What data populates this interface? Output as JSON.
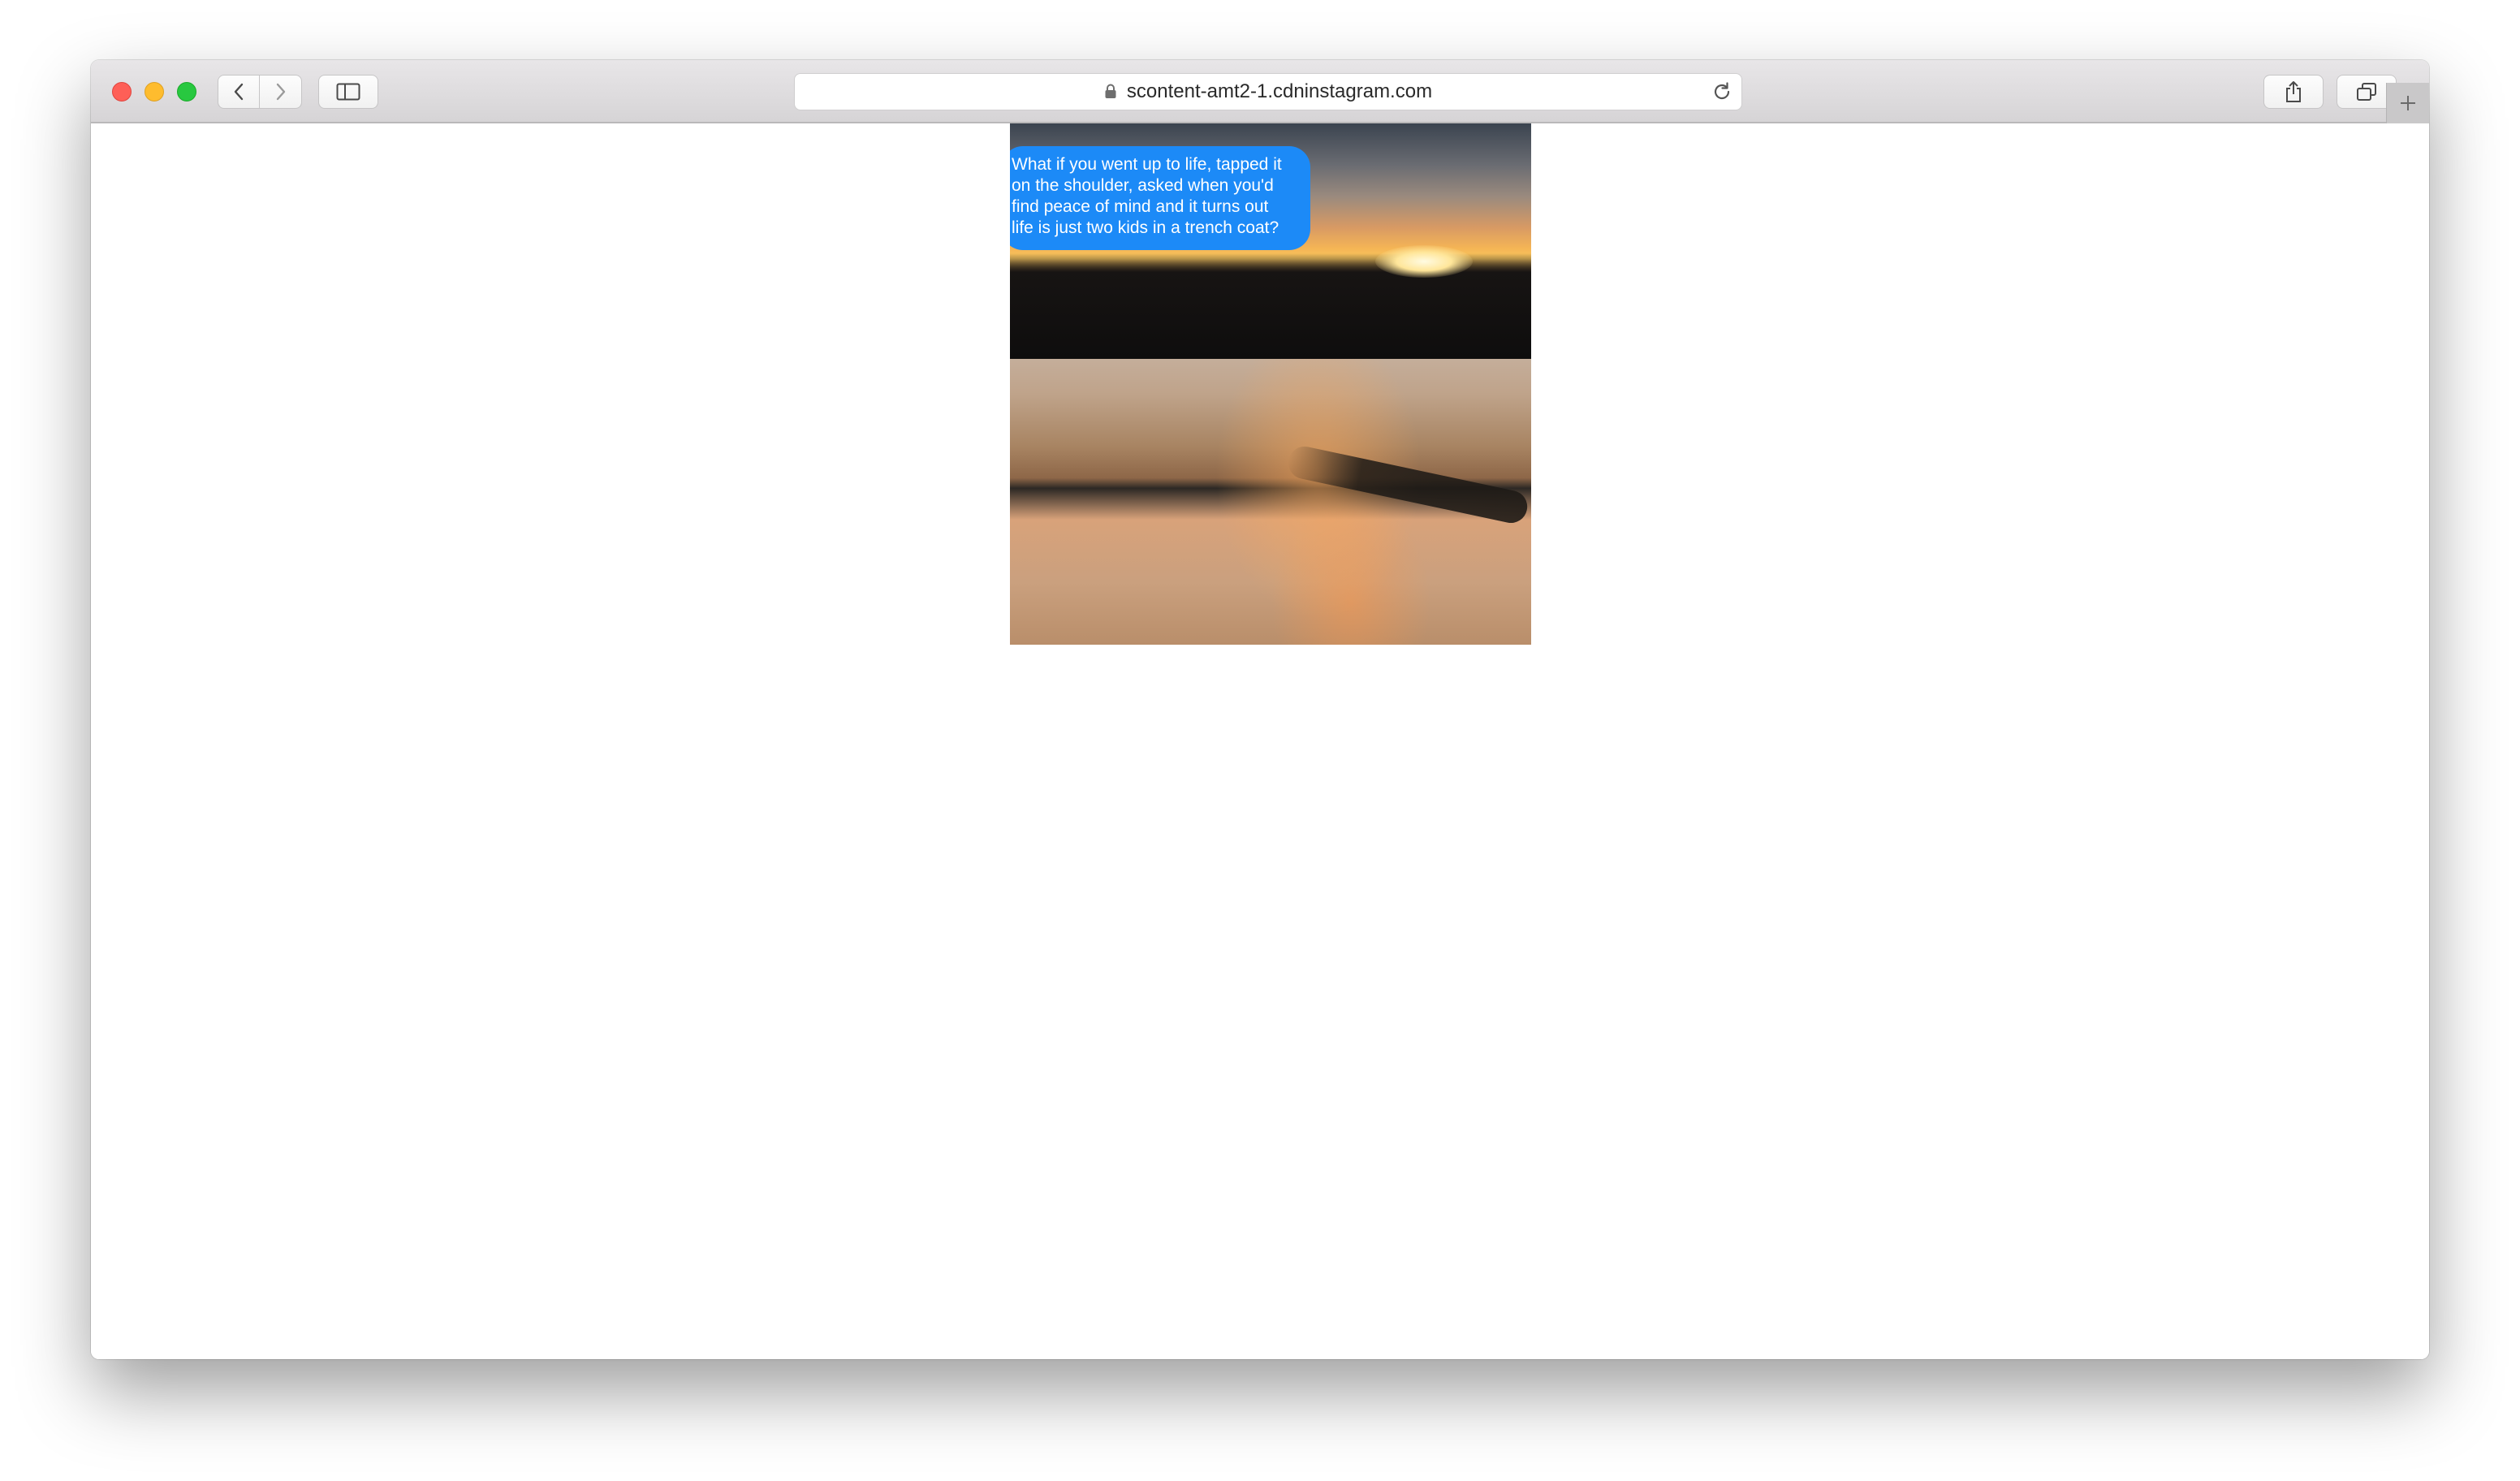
{
  "browser": {
    "url": "scontent-amt2-1.cdninstagram.com",
    "icons": {
      "close": "close-button",
      "minimize": "minimize-button",
      "maximize": "maximize-button",
      "back": "chevron-left-icon",
      "forward": "chevron-right-icon",
      "sidebar": "sidebar-icon",
      "lock": "lock-icon",
      "reload": "reload-icon",
      "share": "share-icon",
      "tabs": "tabs-overview-icon",
      "new_tab": "plus-icon"
    },
    "colors": {
      "close": "#fe5f57",
      "minimize": "#febc2e",
      "maximize": "#28c840",
      "bubble": "#1c8af7"
    }
  },
  "image": {
    "bubble_lines": [
      "What if you went up to life, tapped it",
      "on the shoulder, asked when you'd",
      "find peace of mind and it turns out",
      "life is just two kids in a trench coat?"
    ]
  }
}
